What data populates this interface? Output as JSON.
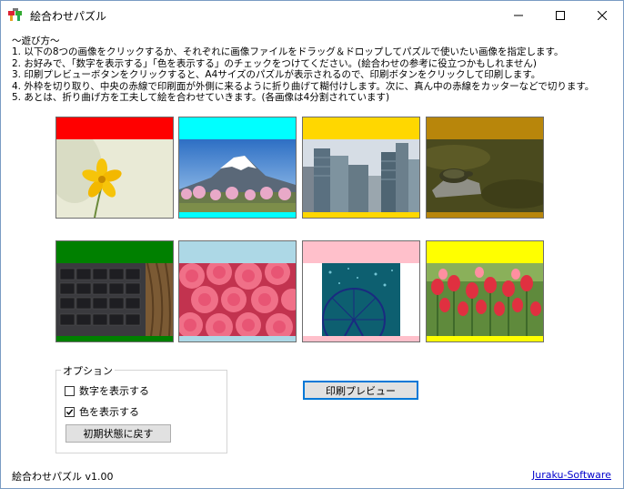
{
  "window": {
    "title": "絵合わせパズル",
    "minimize_icon": "minimize-icon",
    "maximize_icon": "maximize-icon",
    "close_icon": "close-icon"
  },
  "instructions": [
    "〜遊び方〜",
    "1. 以下の8つの画像をクリックするか、それぞれに画像ファイルをドラッグ＆ドロップしてパズルで使いたい画像を指定します。",
    "2. お好みで、「数字を表示する」「色を表示する」のチェックをつけてください。(絵合わせの参考に役立つかもしれません)",
    "3. 印刷プレビューボタンをクリックすると、A4サイズのパズルが表示されるので、印刷ボタンをクリックして印刷します。",
    "4. 外枠を切り取り、中央の赤線で印刷面が外側に来るように折り曲げて糊付けします。次に、真ん中の赤線をカッターなどで切ります。",
    "5. あとは、折り曲げ方を工夫して絵を合わせていきます。(各画像は4分割されています)"
  ],
  "tiles": [
    {
      "name": "tile-flower",
      "color": "#ff0000",
      "subject": "yellow cosmos flower"
    },
    {
      "name": "tile-mountain",
      "color": "#00ffff",
      "subject": "snow mountain with cherry blossoms"
    },
    {
      "name": "tile-city",
      "color": "#ffd700",
      "subject": "city skyscrapers"
    },
    {
      "name": "tile-turtle",
      "color": "#b8860b",
      "subject": "turtles on a rock"
    },
    {
      "name": "tile-keyboard",
      "color": "#008000",
      "subject": "laptop keyboard"
    },
    {
      "name": "tile-roses",
      "color": "#add8e6",
      "subject": "pink roses"
    },
    {
      "name": "tile-ferris",
      "color": "#ffc0cb",
      "subject": "illuminated ferris wheel"
    },
    {
      "name": "tile-tulips",
      "color": "#ffff00",
      "subject": "red tulips"
    }
  ],
  "options": {
    "legend": "オプション",
    "show_numbers": {
      "label": "数字を表示する",
      "checked": false
    },
    "show_colors": {
      "label": "色を表示する",
      "checked": true
    },
    "reset_label": "初期状態に戻す"
  },
  "print_preview_label": "印刷プレビュー",
  "footer": {
    "version": "絵合わせパズル v1.00",
    "link": "Juraku-Software"
  }
}
